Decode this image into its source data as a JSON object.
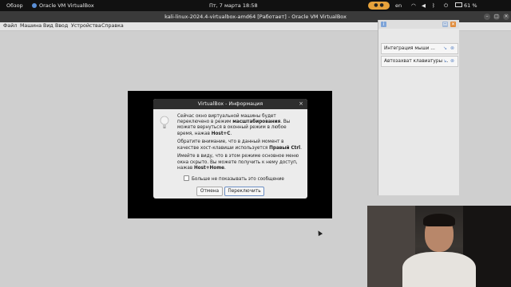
{
  "topbar": {
    "overview": "Обзор",
    "app_name": "Oracle VM VirtualBox",
    "clock": "Пт, 7 марта  18:58",
    "lang": "en",
    "battery": "61 %",
    "accent": "#e7a23b"
  },
  "window": {
    "title": "kali-linux-2024.4-virtualbox-amd64 [Работает] - Oracle VM VirtualBox",
    "menu": [
      "Файл",
      "Машина",
      "Вид",
      "Ввод",
      "Устройства",
      "Справка"
    ]
  },
  "notifications": [
    {
      "text": "Интеграция мыши ..."
    },
    {
      "text": "Автозахват клавиатуры ..."
    }
  ],
  "dialog": {
    "title": "VirtualBox - Информация",
    "close": "×",
    "p1_a": "Сейчас окно виртуальной машины будет переключено в режим ",
    "p1_b": "масштабирования",
    "p1_c": ". Вы можете вернуться в оконный режим в любое время, нажав ",
    "p1_d": "Host+C",
    "p1_e": ".",
    "p2_a": "Обратите внимание, что в данный момент в качестве хост-клавиши используется ",
    "p2_b": "Правый Ctrl",
    "p2_c": ".",
    "p3_a": "Имейте в виду, что в этом режиме основное меню окна скрыто. Вы можете получить к нему доступ, нажав ",
    "p3_b": "Host+Home",
    "p3_c": ".",
    "checkbox": "Больше не показывать это сообщение",
    "cancel": "Отмена",
    "switch": "Переключить"
  }
}
